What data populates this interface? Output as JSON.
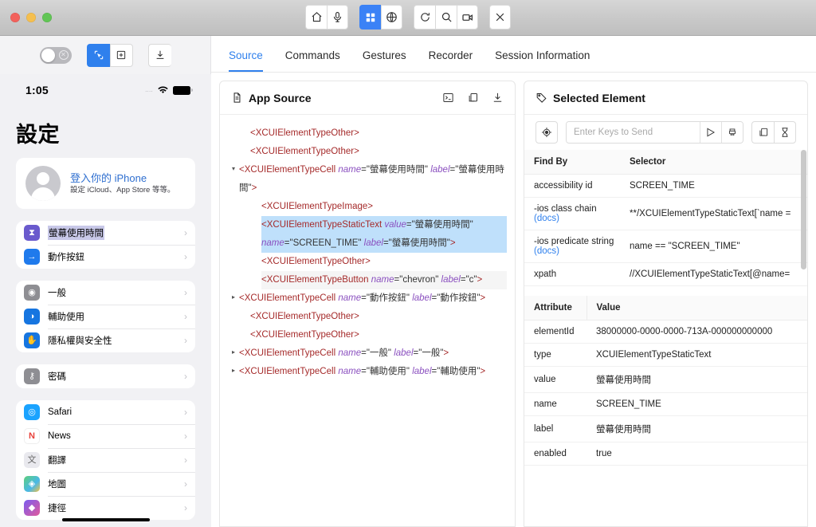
{
  "window": {
    "traffic_lights": [
      "close",
      "minimize",
      "maximize"
    ]
  },
  "titlebar_toolbar": [
    {
      "name": "home-icon",
      "label": "Home",
      "active": false
    },
    {
      "name": "microphone-icon",
      "label": "Microphone",
      "active": false
    },
    {
      "name": "grid-icon",
      "label": "Grid",
      "active": true
    },
    {
      "name": "globe-icon",
      "label": "Globe",
      "active": false
    },
    {
      "name": "refresh-icon",
      "label": "Refresh",
      "active": false
    },
    {
      "name": "search-icon",
      "label": "Search",
      "active": false
    },
    {
      "name": "record-icon",
      "label": "Record",
      "active": false
    },
    {
      "name": "close-icon",
      "label": "Close",
      "active": false
    }
  ],
  "sim_toolbar": {
    "toggle_state": "off",
    "select_label": "Select Element",
    "tap_label": "Tap By Coordinates",
    "download_label": "Save Screenshot"
  },
  "device": {
    "status": {
      "time": "1:05",
      "signal_dots": "....",
      "wifi": "wifi-icon",
      "battery": "battery-icon"
    },
    "page_title": "設定",
    "profile": {
      "name": "登入你的 iPhone",
      "subtitle": "設定 iCloud、App Store 等等。"
    },
    "groups": [
      {
        "rows": [
          {
            "label": "螢幕使用時間",
            "icon": "hourglass",
            "color": "#6a5acd",
            "selected": true
          },
          {
            "label": "動作按鈕",
            "icon": "action",
            "color": "#1f7aec",
            "selected": false
          }
        ]
      },
      {
        "rows": [
          {
            "label": "一般",
            "icon": "gear",
            "color": "#8e8e93",
            "selected": false
          },
          {
            "label": "輔助使用",
            "icon": "accessibility",
            "color": "#1675e0",
            "selected": false
          },
          {
            "label": "隱私權與安全性",
            "icon": "hand",
            "color": "#1675e0",
            "selected": false
          }
        ]
      },
      {
        "rows": [
          {
            "label": "密碼",
            "icon": "key",
            "color": "#8e8e93",
            "selected": false
          }
        ]
      },
      {
        "rows": [
          {
            "label": "Safari",
            "icon": "safari",
            "color": "#1aa3ff",
            "selected": false
          },
          {
            "label": "News",
            "icon": "news",
            "color": "#ffffff",
            "selected": false
          },
          {
            "label": "翻譯",
            "icon": "translate",
            "color": "#e9e9ee",
            "selected": false
          },
          {
            "label": "地圖",
            "icon": "maps",
            "color": "#4cd964",
            "selected": false
          },
          {
            "label": "捷徑",
            "icon": "shortcuts",
            "color": "#6b4fd8",
            "selected": false
          }
        ]
      }
    ]
  },
  "tabs": [
    {
      "label": "Source",
      "active": true
    },
    {
      "label": "Commands",
      "active": false
    },
    {
      "label": "Gestures",
      "active": false
    },
    {
      "label": "Recorder",
      "active": false
    },
    {
      "label": "Session Information",
      "active": false
    }
  ],
  "source_panel": {
    "title": "App Source",
    "title_icon": "document-icon",
    "actions": [
      {
        "name": "console-icon",
        "label": "Open Console"
      },
      {
        "name": "copy-icon",
        "label": "Copy XML"
      },
      {
        "name": "download-icon",
        "label": "Download XML"
      }
    ],
    "tree": [
      {
        "indent": 1,
        "twisty": "",
        "tag": "XCUIElementTypeOther",
        "attrs": []
      },
      {
        "indent": 1,
        "twisty": "",
        "tag": "XCUIElementTypeOther",
        "attrs": []
      },
      {
        "indent": 0,
        "twisty": "▾",
        "tag": "XCUIElementTypeCell",
        "attrs": [
          {
            "k": "name",
            "v": "螢幕使用時間"
          },
          {
            "k": "label",
            "v": "螢幕使用時間"
          }
        ]
      },
      {
        "indent": 2,
        "twisty": "",
        "tag": "XCUIElementTypeImage",
        "attrs": []
      },
      {
        "indent": 2,
        "twisty": "",
        "tag": "XCUIElementTypeStaticText",
        "highlight": true,
        "attrs": [
          {
            "k": "value",
            "v": "螢幕使用時間"
          },
          {
            "k": "name",
            "v": "SCREEN_TIME"
          },
          {
            "k": "label",
            "v": "螢幕使用時間"
          }
        ]
      },
      {
        "indent": 2,
        "twisty": "",
        "tag": "XCUIElementTypeOther",
        "attrs": []
      },
      {
        "indent": 2,
        "twisty": "",
        "tag": "XCUIElementTypeButton",
        "subtle": true,
        "attrs": [
          {
            "k": "name",
            "v": "chevron"
          },
          {
            "k": "label",
            "v": "c"
          }
        ]
      },
      {
        "indent": 0,
        "twisty": "▸",
        "tag": "XCUIElementTypeCell",
        "attrs": [
          {
            "k": "name",
            "v": "動作按鈕"
          },
          {
            "k": "label",
            "v": "動作按鈕"
          }
        ]
      },
      {
        "indent": 1,
        "twisty": "",
        "tag": "XCUIElementTypeOther",
        "attrs": []
      },
      {
        "indent": 1,
        "twisty": "",
        "tag": "XCUIElementTypeOther",
        "attrs": []
      },
      {
        "indent": 0,
        "twisty": "▸",
        "tag": "XCUIElementTypeCell",
        "attrs": [
          {
            "k": "name",
            "v": "一般"
          },
          {
            "k": "label",
            "v": "一般"
          }
        ]
      },
      {
        "indent": 0,
        "twisty": "▸",
        "tag": "XCUIElementTypeCell",
        "attrs": [
          {
            "k": "name",
            "v": "輔助使用"
          },
          {
            "k": "label",
            "v": "輔助使用"
          }
        ]
      }
    ]
  },
  "selected_panel": {
    "title": "Selected Element",
    "title_icon": "tag-icon",
    "keys_placeholder": "Enter Keys to Send",
    "keys_value": "",
    "actions": [
      {
        "name": "tap-icon",
        "label": "Tap"
      },
      {
        "name": "send-keys-icon",
        "label": "Send Keys"
      },
      {
        "name": "clear-icon",
        "label": "Clear"
      },
      {
        "name": "copy-icon",
        "label": "Copy"
      },
      {
        "name": "timer-icon",
        "label": "Get Timing"
      }
    ],
    "find_by_table": {
      "headers": [
        "Find By",
        "Selector"
      ],
      "rows": [
        {
          "find_by": "accessibility id",
          "docs": "",
          "selector": "SCREEN_TIME"
        },
        {
          "find_by": "-ios class chain",
          "docs": "(docs)",
          "selector": "**/XCUIElementTypeStaticText[`name ="
        },
        {
          "find_by": "-ios predicate string",
          "docs": "(docs)",
          "selector": "name == \"SCREEN_TIME\""
        },
        {
          "find_by": "xpath",
          "docs": "",
          "selector": "//XCUIElementTypeStaticText[@name="
        }
      ]
    },
    "attribute_table": {
      "headers": [
        "Attribute",
        "Value"
      ],
      "rows": [
        {
          "attribute": "elementId",
          "value": "38000000-0000-0000-713A-000000000000"
        },
        {
          "attribute": "type",
          "value": "XCUIElementTypeStaticText"
        },
        {
          "attribute": "value",
          "value": "螢幕使用時間"
        },
        {
          "attribute": "name",
          "value": "SCREEN_TIME"
        },
        {
          "attribute": "label",
          "value": "螢幕使用時間"
        },
        {
          "attribute": "enabled",
          "value": "true"
        }
      ]
    }
  },
  "colors": {
    "accent": "#2f80ed",
    "active_tab": "#2f80ed",
    "highlight": "#bfe0fb",
    "tag": "#a52a2a",
    "attr": "#8a4fbf",
    "link": "#2f80ed"
  }
}
